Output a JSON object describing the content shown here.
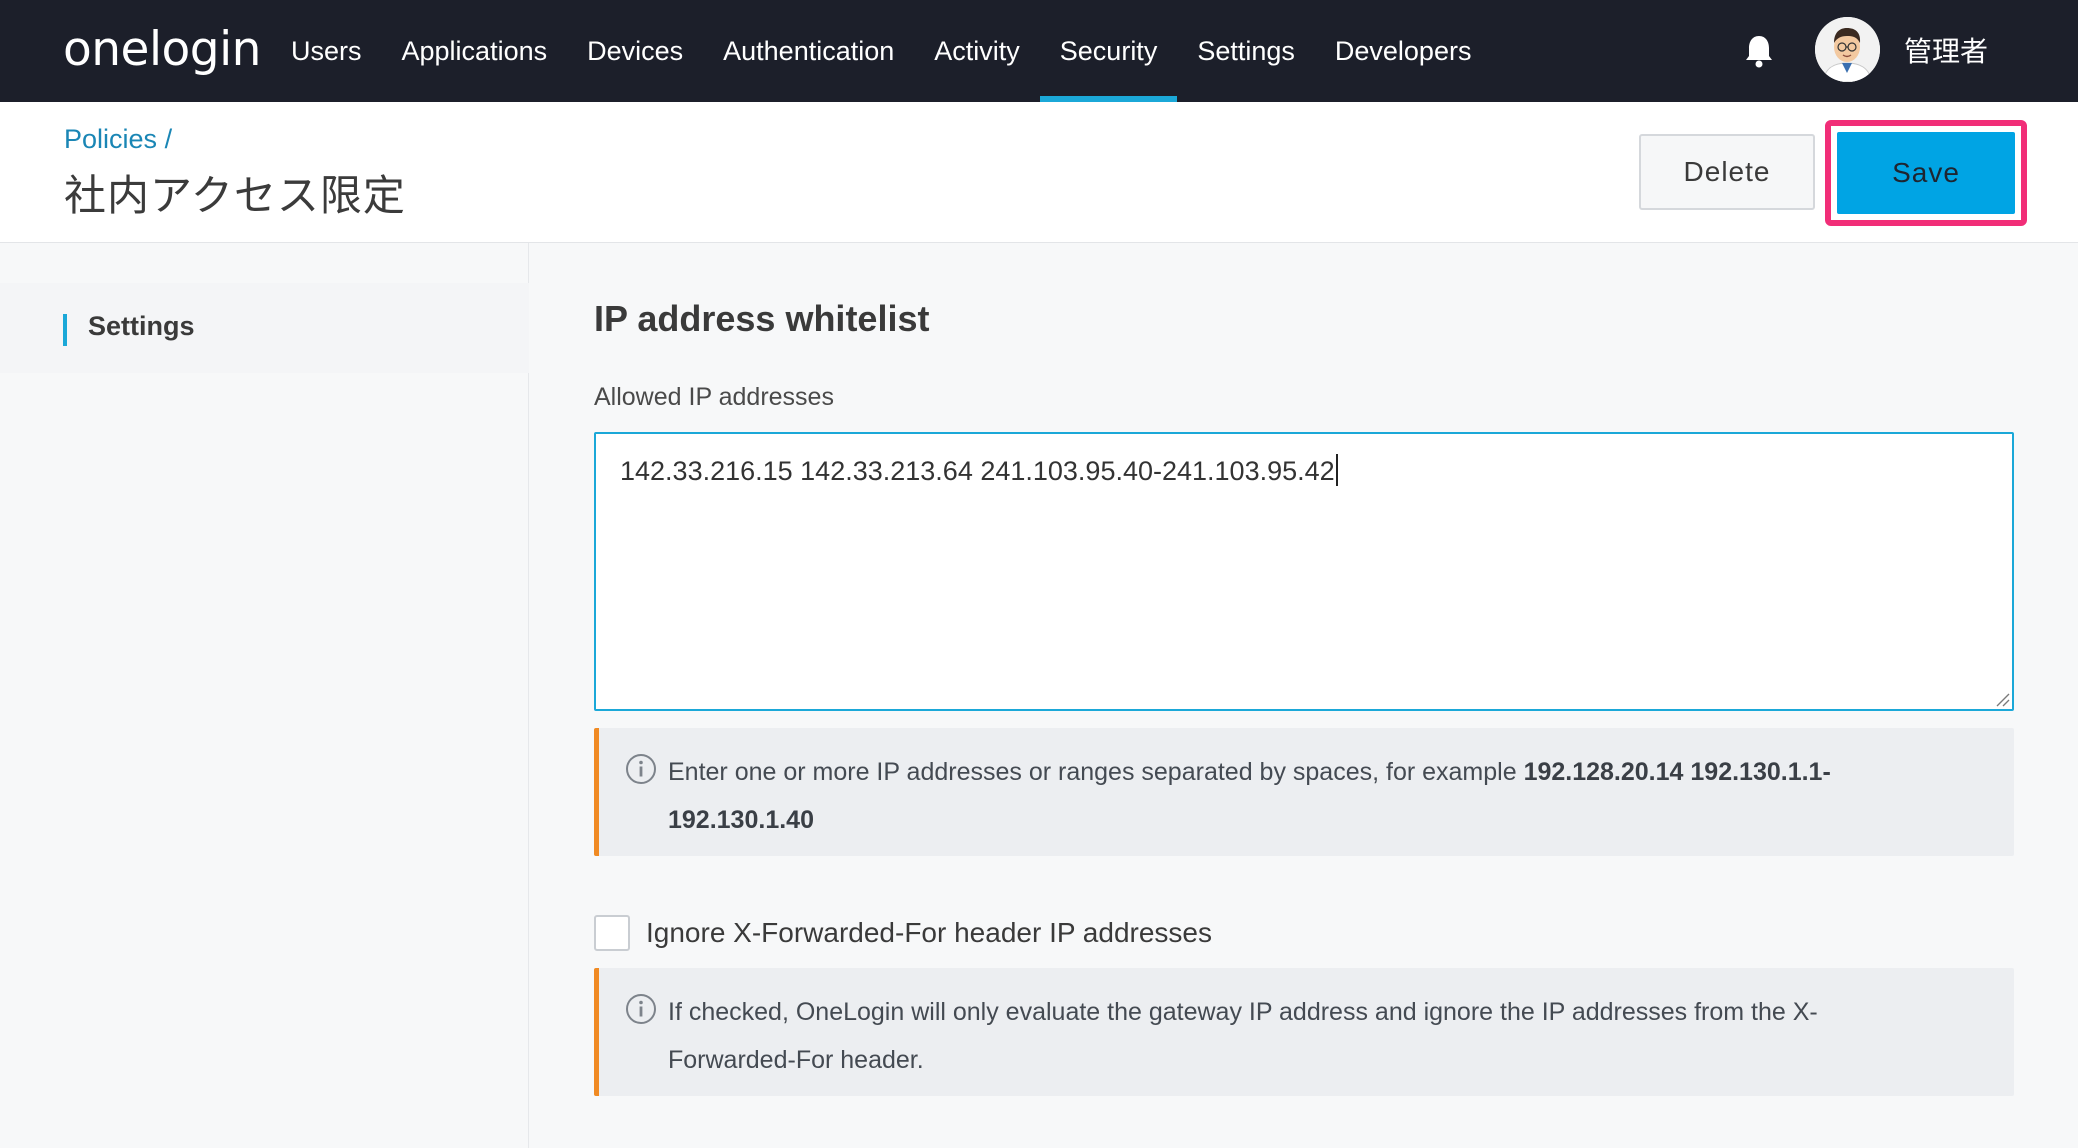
{
  "brand": {
    "logo_text": "onelogin"
  },
  "nav": {
    "items": [
      {
        "label": "Users",
        "active": false
      },
      {
        "label": "Applications",
        "active": false
      },
      {
        "label": "Devices",
        "active": false
      },
      {
        "label": "Authentication",
        "active": false
      },
      {
        "label": "Activity",
        "active": false
      },
      {
        "label": "Security",
        "active": true
      },
      {
        "label": "Settings",
        "active": false
      },
      {
        "label": "Developers",
        "active": false
      }
    ],
    "notification_icon": "bell-icon",
    "user_name": "管理者",
    "accent_color": "#1ba8d8"
  },
  "header": {
    "breadcrumb_link": "Policies",
    "breadcrumb_separator": "/",
    "title": "社内アクセス限定",
    "delete_label": "Delete",
    "save_label": "Save",
    "save_color": "#00a4e4",
    "highlight_color": "#f12e78"
  },
  "sidebar": {
    "items": [
      {
        "label": "Settings",
        "active": true
      }
    ]
  },
  "main": {
    "section_title": "IP address whitelist",
    "allowed_ips_label": "Allowed IP addresses",
    "allowed_ips_value": "142.33.216.15 142.33.213.64 241.103.95.40-241.103.95.42",
    "info_1_text": "Enter one or more IP addresses or ranges separated by spaces, for example ",
    "info_1_example": "192.128.20.14 192.130.1.1-192.130.1.40",
    "ignore_xff_label": "Ignore X-Forwarded-For header IP addresses",
    "ignore_xff_checked": false,
    "info_2_text": "If checked, OneLogin will only evaluate the gateway IP address and ignore the IP addresses from the X-Forwarded-For header.",
    "info_icon": "info-icon",
    "info_border_color": "#f08a24"
  }
}
